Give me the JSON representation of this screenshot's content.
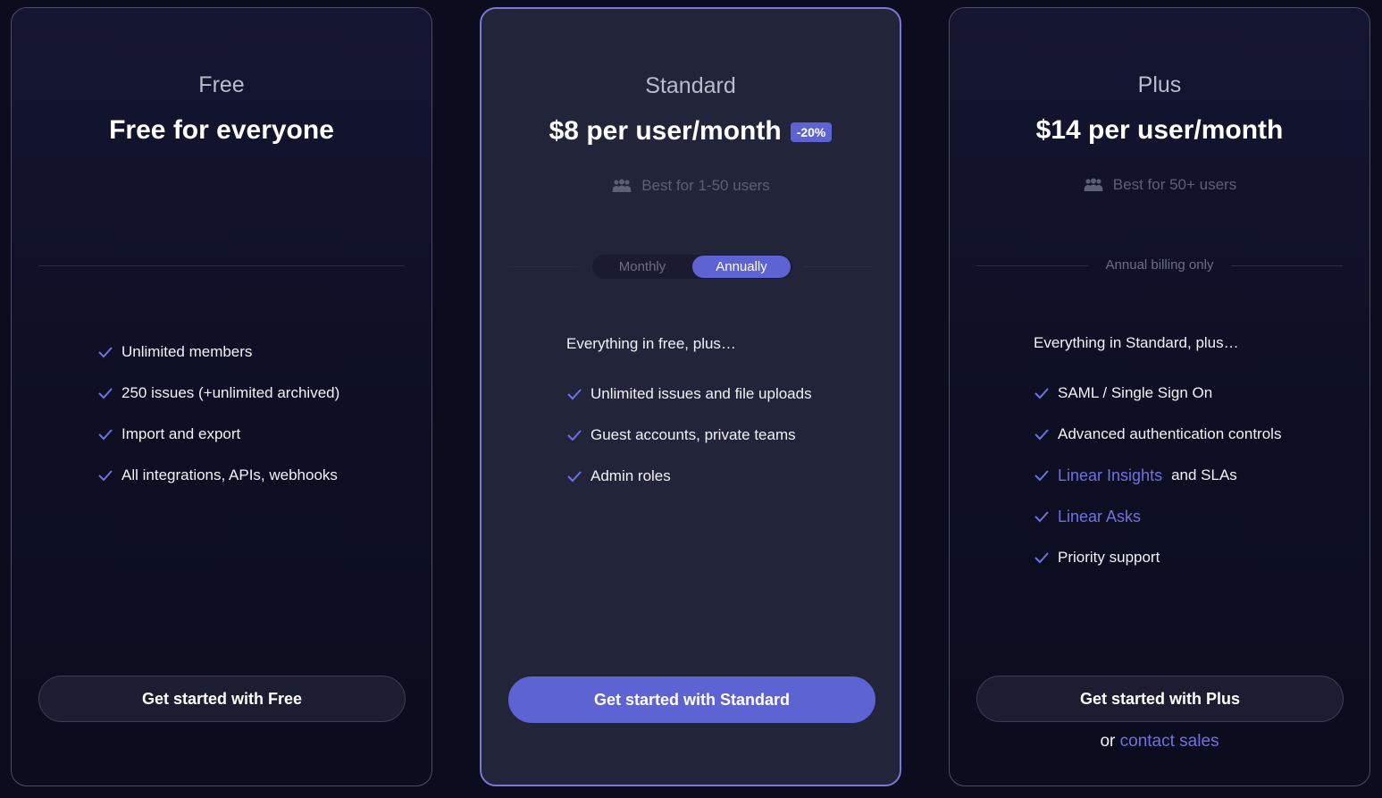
{
  "colors": {
    "accent": "#5e63d4",
    "link": "#6e72e0",
    "background": "#0b0c1e",
    "highlight_card": "#22243a",
    "highlight_border": "#7a78d6"
  },
  "free": {
    "name": "Free",
    "price": "Free for everyone",
    "features": [
      "Unlimited members",
      "250 issues (+unlimited archived)",
      "Import and export",
      "All integrations, APIs, webhooks"
    ],
    "cta": "Get started with Free"
  },
  "standard": {
    "name": "Standard",
    "price": "$8 per user/month",
    "discount": "-20%",
    "best_for": "Best for 1-50 users",
    "billing_toggle": {
      "monthly": "Monthly",
      "annually": "Annually",
      "selected": "Annually"
    },
    "intro": "Everything in free, plus…",
    "features": [
      "Unlimited issues and file uploads",
      "Guest accounts, private teams",
      "Admin roles"
    ],
    "cta": "Get started with Standard"
  },
  "plus": {
    "name": "Plus",
    "price": "$14 per user/month",
    "best_for": "Best for 50+ users",
    "billing_note": "Annual billing only",
    "intro": "Everything in Standard, plus…",
    "features": {
      "saml": "SAML / Single Sign On",
      "auth": "Advanced authentication controls",
      "insights_link": "Linear Insights",
      "insights_suffix": "and SLAs",
      "asks_link": "Linear Asks",
      "support": "Priority support"
    },
    "cta": "Get started with Plus",
    "contact_prefix": "or",
    "contact_link": "contact sales"
  },
  "icons": {
    "check": "check-icon",
    "users": "users-icon"
  }
}
